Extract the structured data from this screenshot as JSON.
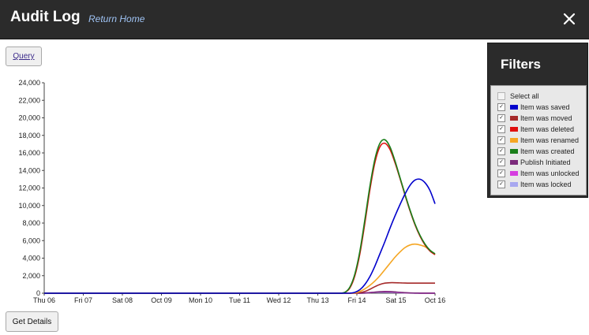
{
  "header": {
    "title": "Audit Log",
    "home_link": "Return Home",
    "close_symbol": "✕"
  },
  "toolbar": {
    "query_label": "Query",
    "details_label": "Get Details"
  },
  "filters": {
    "title": "Filters",
    "select_all": {
      "label": "Select all",
      "checked": false
    },
    "items": [
      {
        "label": "Item was saved",
        "color": "#0000cc",
        "checked": true
      },
      {
        "label": "Item was moved",
        "color": "#a52a2a",
        "checked": true
      },
      {
        "label": "Item was deleted",
        "color": "#e01010",
        "checked": true
      },
      {
        "label": "Item was renamed",
        "color": "#f5a623",
        "checked": true
      },
      {
        "label": "Item was created",
        "color": "#1a7f1a",
        "checked": true
      },
      {
        "label": "Publish Initiated",
        "color": "#7b2a7b",
        "checked": true
      },
      {
        "label": "Item was unlocked",
        "color": "#d63fe0",
        "checked": true
      },
      {
        "label": "Item was locked",
        "color": "#a8a8f0",
        "checked": true
      }
    ]
  },
  "chart_data": {
    "type": "line",
    "x_categories": [
      "Thu 06",
      "Fri 07",
      "Sat 08",
      "Oct 09",
      "Mon 10",
      "Tue 11",
      "Wed 12",
      "Thu 13",
      "Fri 14",
      "Sat 15",
      "Oct 16"
    ],
    "ylim": [
      0,
      24000
    ],
    "y_ticks": [
      "0",
      "2,000",
      "4,000",
      "6,000",
      "8,000",
      "10,000",
      "12,000",
      "14,000",
      "16,000",
      "18,000",
      "20,000",
      "22,000",
      "24,000"
    ],
    "grid": false,
    "series": [
      {
        "name": "Item was saved",
        "color": "#0000cc",
        "values": [
          0,
          0,
          0,
          0,
          0,
          0,
          0,
          0,
          0,
          0,
          0,
          0,
          0,
          0,
          0,
          0,
          0,
          0,
          0,
          0,
          0,
          0,
          0,
          0,
          0,
          0,
          0,
          0,
          0,
          0,
          0,
          0,
          0,
          0,
          0,
          0,
          0,
          0,
          0,
          0,
          0,
          0,
          0,
          0,
          0,
          0,
          0,
          0,
          0,
          0,
          0,
          0,
          0,
          0,
          0,
          0,
          0,
          0,
          0,
          0,
          0,
          10,
          100,
          400,
          1000,
          1900,
          3100,
          4500,
          5900,
          7400,
          8800,
          10100,
          11300,
          12300,
          12900,
          13000,
          12600,
          11700,
          10200
        ]
      },
      {
        "name": "Item was moved",
        "color": "#a52a2a",
        "values": [
          0,
          0,
          0,
          0,
          0,
          0,
          0,
          0,
          0,
          0,
          0,
          0,
          0,
          0,
          0,
          0,
          0,
          0,
          0,
          0,
          0,
          0,
          0,
          0,
          0,
          0,
          0,
          0,
          0,
          0,
          0,
          0,
          0,
          0,
          0,
          0,
          0,
          0,
          0,
          0,
          0,
          0,
          0,
          0,
          0,
          0,
          0,
          0,
          0,
          0,
          0,
          0,
          0,
          0,
          0,
          0,
          0,
          0,
          0,
          0,
          0,
          0,
          10,
          60,
          200,
          450,
          750,
          1000,
          1150,
          1200,
          1200,
          1180,
          1160,
          1150,
          1150,
          1150,
          1150,
          1150,
          1150
        ]
      },
      {
        "name": "Item was deleted",
        "color": "#e01010",
        "values": [
          0,
          0,
          0,
          0,
          0,
          0,
          0,
          0,
          0,
          0,
          0,
          0,
          0,
          0,
          0,
          0,
          0,
          0,
          0,
          0,
          0,
          0,
          0,
          0,
          0,
          0,
          0,
          0,
          0,
          0,
          0,
          0,
          0,
          0,
          0,
          0,
          0,
          0,
          0,
          0,
          0,
          0,
          0,
          0,
          0,
          0,
          0,
          0,
          0,
          0,
          0,
          0,
          0,
          0,
          0,
          0,
          0,
          0,
          0,
          0,
          100,
          600,
          2000,
          4500,
          8000,
          11800,
          14900,
          16700,
          17100,
          16400,
          14900,
          13100,
          11200,
          9400,
          7800,
          6500,
          5500,
          4800,
          4400
        ]
      },
      {
        "name": "Item was renamed",
        "color": "#f5a623",
        "values": [
          0,
          0,
          0,
          0,
          0,
          0,
          0,
          0,
          0,
          0,
          0,
          0,
          0,
          0,
          0,
          0,
          0,
          0,
          0,
          0,
          0,
          0,
          0,
          0,
          0,
          0,
          0,
          0,
          0,
          0,
          0,
          0,
          0,
          0,
          0,
          0,
          0,
          0,
          0,
          0,
          0,
          0,
          0,
          0,
          0,
          0,
          0,
          0,
          0,
          0,
          0,
          0,
          0,
          0,
          0,
          0,
          0,
          0,
          0,
          0,
          0,
          0,
          30,
          200,
          500,
          900,
          1400,
          2000,
          2700,
          3400,
          4100,
          4700,
          5200,
          5500,
          5600,
          5500,
          5300,
          4900,
          4400
        ]
      },
      {
        "name": "Item was created",
        "color": "#1a7f1a",
        "values": [
          0,
          0,
          0,
          0,
          0,
          0,
          0,
          0,
          0,
          0,
          0,
          0,
          0,
          0,
          0,
          0,
          0,
          0,
          0,
          0,
          0,
          0,
          0,
          0,
          0,
          0,
          0,
          0,
          0,
          0,
          0,
          0,
          0,
          0,
          0,
          0,
          0,
          0,
          0,
          0,
          0,
          0,
          0,
          0,
          0,
          0,
          0,
          0,
          0,
          0,
          0,
          0,
          0,
          0,
          0,
          0,
          0,
          0,
          0,
          0,
          100,
          700,
          2200,
          4800,
          8400,
          12200,
          15300,
          17100,
          17500,
          16700,
          15100,
          13200,
          11300,
          9500,
          7900,
          6600,
          5600,
          4900,
          4500
        ]
      },
      {
        "name": "Publish Initiated",
        "color": "#7b2a7b",
        "values": [
          0,
          0,
          0,
          0,
          0,
          0,
          0,
          0,
          0,
          0,
          0,
          0,
          0,
          0,
          0,
          0,
          0,
          0,
          0,
          0,
          0,
          0,
          0,
          0,
          0,
          0,
          0,
          0,
          0,
          0,
          0,
          0,
          0,
          0,
          0,
          0,
          0,
          0,
          0,
          0,
          0,
          0,
          0,
          0,
          0,
          0,
          0,
          0,
          0,
          0,
          0,
          0,
          0,
          0,
          0,
          0,
          0,
          0,
          0,
          0,
          0,
          0,
          0,
          0,
          20,
          60,
          120,
          170,
          200,
          190,
          150,
          100,
          60,
          30,
          20,
          10,
          10,
          10,
          10
        ]
      },
      {
        "name": "Item was unlocked",
        "color": "#d63fe0",
        "values": [
          0,
          0,
          0,
          0,
          0,
          0,
          0,
          0,
          0,
          0,
          0,
          0,
          0,
          0,
          0,
          0,
          0,
          0,
          0,
          0,
          0,
          0,
          0,
          0,
          0,
          0,
          0,
          0,
          0,
          0,
          0,
          0,
          0,
          0,
          0,
          0,
          0,
          0,
          0,
          0,
          0,
          0,
          0,
          0,
          0,
          0,
          0,
          0,
          0,
          0,
          0,
          0,
          0,
          0,
          0,
          0,
          0,
          0,
          0,
          0,
          0,
          0,
          0,
          10,
          40,
          80,
          120,
          150,
          160,
          150,
          120,
          80,
          50,
          30,
          20,
          10,
          10,
          10,
          10
        ]
      },
      {
        "name": "Item was locked",
        "color": "#a8a8f0",
        "values": [
          0,
          0,
          0,
          0,
          0,
          0,
          0,
          0,
          0,
          0,
          0,
          0,
          0,
          0,
          0,
          0,
          0,
          0,
          0,
          0,
          0,
          0,
          0,
          0,
          0,
          0,
          0,
          0,
          0,
          0,
          0,
          0,
          0,
          0,
          0,
          0,
          0,
          0,
          0,
          0,
          0,
          0,
          0,
          0,
          0,
          0,
          0,
          0,
          0,
          0,
          0,
          0,
          0,
          0,
          0,
          0,
          0,
          0,
          0,
          0,
          0,
          0,
          0,
          10,
          30,
          60,
          90,
          110,
          120,
          110,
          90,
          60,
          40,
          20,
          10,
          10,
          10,
          10,
          10
        ]
      }
    ]
  }
}
